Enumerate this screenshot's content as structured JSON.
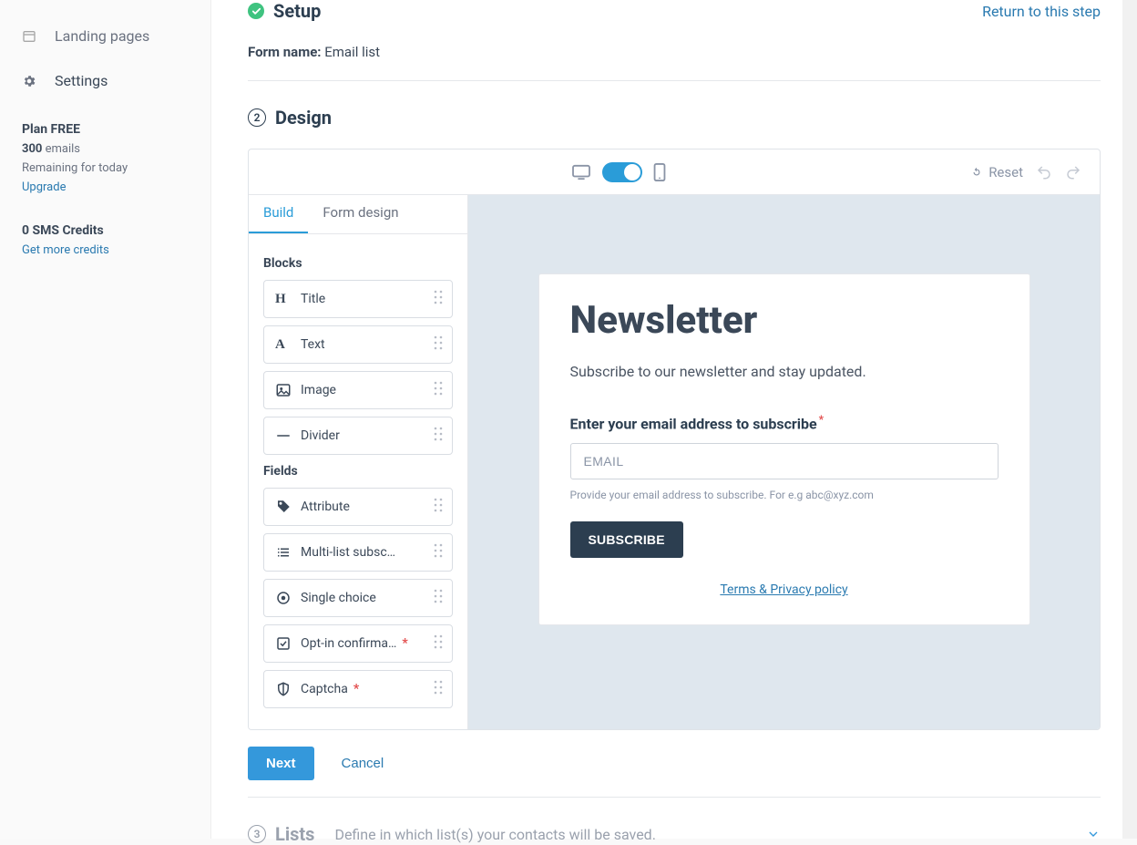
{
  "sidebar": {
    "items": [
      {
        "label": "Landing pages"
      },
      {
        "label": "Settings"
      }
    ],
    "plan": {
      "title": "Plan FREE",
      "emails_count": "300",
      "emails_suffix": " emails",
      "remaining_label": "Remaining for today",
      "upgrade_label": "Upgrade"
    },
    "sms": {
      "title": "0 SMS Credits",
      "more_label": "Get more credits"
    }
  },
  "steps": {
    "setup": {
      "title": "Setup",
      "return_label": "Return to this step",
      "form_name_label": "Form name:",
      "form_name_value": "Email list"
    },
    "design": {
      "num": "2",
      "title": "Design",
      "toolbar": {
        "reset_label": "Reset"
      },
      "tabs": {
        "build": "Build",
        "form_design": "Form design"
      },
      "blocks_title": "Blocks",
      "blocks": [
        {
          "label": "Title",
          "icon": "heading"
        },
        {
          "label": "Text",
          "icon": "font"
        },
        {
          "label": "Image",
          "icon": "image"
        },
        {
          "label": "Divider",
          "icon": "divider"
        }
      ],
      "fields_title": "Fields",
      "fields": [
        {
          "label": "Attribute",
          "icon": "tag",
          "required": false
        },
        {
          "label": "Multi-list subsc…",
          "icon": "list",
          "required": false
        },
        {
          "label": "Single choice",
          "icon": "radio",
          "required": false
        },
        {
          "label": "Opt-in confirma…",
          "icon": "checkbox",
          "required": true
        },
        {
          "label": "Captcha",
          "icon": "shield",
          "required": true
        }
      ],
      "preview": {
        "heading": "Newsletter",
        "sub": "Subscribe to our newsletter and stay updated.",
        "field_label": "Enter your email address to subscribe",
        "placeholder": "EMAIL",
        "help": "Provide your email address to subscribe. For e.g abc@xyz.com",
        "button": "SUBSCRIBE",
        "terms": "Terms & Privacy policy"
      }
    },
    "lists": {
      "num": "3",
      "title": "Lists",
      "desc": "Define in which list(s) your contacts will be saved."
    }
  },
  "footer": {
    "next": "Next",
    "cancel": "Cancel"
  }
}
